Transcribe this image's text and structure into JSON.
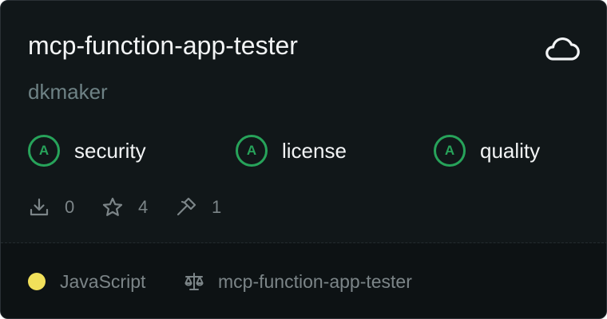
{
  "repo": {
    "name": "mcp-function-app-tester",
    "owner": "dkmaker",
    "type_icon": "cloud-icon"
  },
  "scores": [
    {
      "grade": "A",
      "label": "security"
    },
    {
      "grade": "A",
      "label": "license"
    },
    {
      "grade": "A",
      "label": "quality"
    }
  ],
  "stats": {
    "downloads": "0",
    "stars": "4",
    "tools": "1"
  },
  "footer": {
    "language": "JavaScript",
    "language_color": "#f1e05a",
    "license_name": "mcp-function-app-tester"
  },
  "colors": {
    "grade_accent": "#27a35a",
    "background": "#111719"
  }
}
